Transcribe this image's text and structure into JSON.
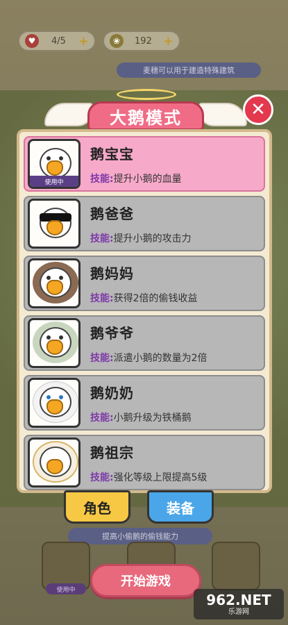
{
  "hud": {
    "lives": "4/5",
    "wheat": "192",
    "hint": "麦穗可以用于建造特殊建筑"
  },
  "modal": {
    "title": "大鹅模式",
    "close_icon": "close-icon",
    "skill_label": "技能:",
    "used_tag": "使用中",
    "characters": [
      {
        "name": "鹅宝宝",
        "skill": "提升小鹅的血量",
        "active": true
      },
      {
        "name": "鹅爸爸",
        "skill": "提升小鹅的攻击力",
        "active": false
      },
      {
        "name": "鹅妈妈",
        "skill": "获得2倍的偷钱收益",
        "active": false
      },
      {
        "name": "鹅爷爷",
        "skill": "派遣小鹅的数量为2倍",
        "active": false
      },
      {
        "name": "鹅奶奶",
        "skill": "小鹅升级为铁桶鹅",
        "active": false
      },
      {
        "name": "鹅祖宗",
        "skill": "强化等级上限提高5级",
        "active": false
      }
    ],
    "tabs": {
      "role": "角色",
      "equip": "装备"
    }
  },
  "background": {
    "skill_bar": "提高小偷鹅的偷钱能力",
    "used_tag": "使用中",
    "start_button": "开始游戏"
  },
  "watermark": {
    "main": "962.NET",
    "sub": "乐游网"
  },
  "colors": {
    "active_card": "#f7a9c9",
    "inactive_card": "#b7b7b7",
    "title": "#f06c86",
    "close": "#e3384d",
    "start": "#e8697c"
  }
}
